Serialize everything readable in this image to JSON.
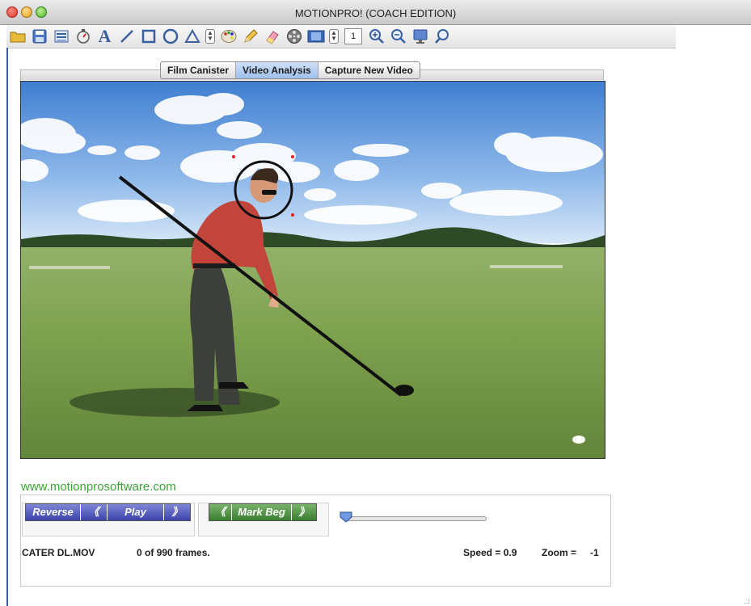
{
  "window": {
    "title": "MOTIONPRO! (COACH EDITION)"
  },
  "toolbar": {
    "icons": [
      "folder-icon",
      "save-icon",
      "list-icon",
      "stopwatch-icon",
      "text-icon",
      "line-icon",
      "rectangle-icon",
      "circle-icon",
      "triangle-icon",
      "stepper-icon",
      "palette-icon",
      "pencil-icon",
      "eraser-icon",
      "reel-icon",
      "filmstrip-icon",
      "stepper-icon",
      "zoom-in-icon",
      "zoom-out-icon",
      "monitor-icon",
      "search-icon"
    ],
    "line_width": "1"
  },
  "tabs": [
    "Film Canister",
    "Video Analysis",
    "Capture New Video"
  ],
  "active_tab": "Video Analysis",
  "website": "www.motionprosoftware.com",
  "playback": {
    "reverse": "Reverse",
    "prev": "《",
    "play": "Play",
    "next": "》",
    "mark_prev": "《",
    "mark_beg": "Mark Beg",
    "mark_next": "》",
    "position": 0.0
  },
  "status": {
    "filename": "CATER DL.MOV",
    "frames": "0 of 990 frames.",
    "speed": "Speed = 0.9",
    "zoom_label": "Zoom =",
    "zoom_value": "-1"
  },
  "colors": {
    "accent": "#3a5fa0",
    "website": "#3aa535",
    "marker": "#e02020"
  }
}
